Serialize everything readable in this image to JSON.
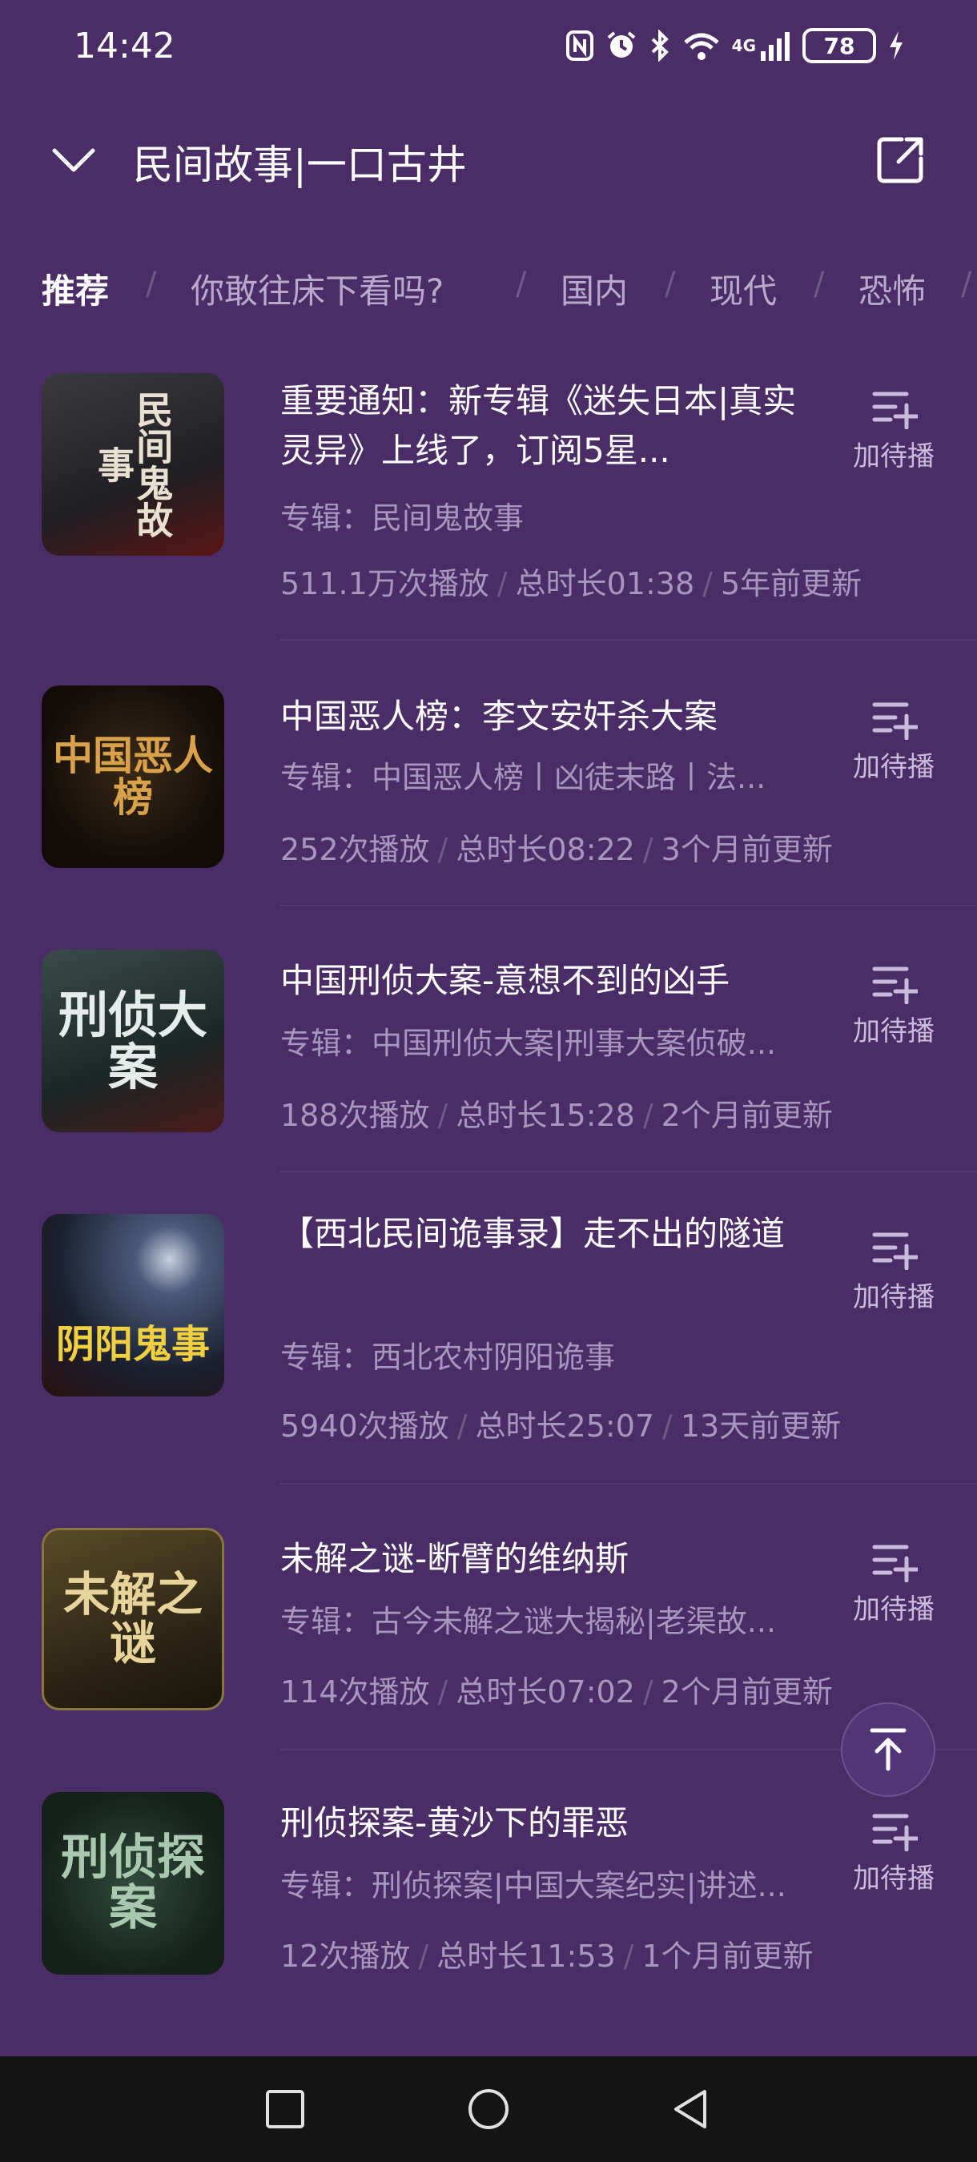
{
  "status_bar": {
    "time": "14:42",
    "icons": [
      "nfc-icon",
      "alarm-icon",
      "bluetooth-icon",
      "wifi-icon",
      "signal-icon",
      "charging-icon"
    ],
    "network_label": "4G",
    "battery_level": "78"
  },
  "header": {
    "title": "民间故事|一口古井",
    "back_icon": "chevron-down-icon",
    "share_icon": "share-icon"
  },
  "tabs": [
    {
      "label": "推荐",
      "active": true
    },
    {
      "label": "你敢往床下看吗?",
      "active": false
    },
    {
      "label": "国内",
      "active": false
    },
    {
      "label": "现代",
      "active": false
    },
    {
      "label": "恐怖",
      "active": false
    }
  ],
  "queue_label": "加待播",
  "items": [
    {
      "title": "重要通知：新专辑《迷失日本|真实灵异》上线了，订阅5星...",
      "album": "专辑：民间鬼故事",
      "plays": "511.1万次播放",
      "duration": "总时长01:38",
      "updated": "5年前更新",
      "cover_text": "民间鬼故事"
    },
    {
      "title": "中国恶人榜：李文安奸杀大案",
      "album": "专辑：中国恶人榜丨凶徒末路丨法...",
      "plays": "252次播放",
      "duration": "总时长08:22",
      "updated": "3个月前更新",
      "cover_text": "中国恶人榜"
    },
    {
      "title": "中国刑侦大案-意想不到的凶手",
      "album": "专辑：中国刑侦大案|刑事大案侦破...",
      "plays": "188次播放",
      "duration": "总时长15:28",
      "updated": "2个月前更新",
      "cover_text": "刑侦大案"
    },
    {
      "title": "【西北民间诡事录】走不出的隧道",
      "album": "专辑：西北农村阴阳诡事",
      "plays": "5940次播放",
      "duration": "总时长25:07",
      "updated": "13天前更新",
      "cover_text": "阴阳鬼事"
    },
    {
      "title": "未解之谜-断臂的维纳斯",
      "album": "专辑：古今未解之谜大揭秘|老渠故...",
      "plays": "114次播放",
      "duration": "总时长07:02",
      "updated": "2个月前更新",
      "cover_text": "未解之谜"
    },
    {
      "title": "刑侦探案-黄沙下的罪恶",
      "album": "专辑：刑侦探案|中国大案纪实|讲述...",
      "plays": "12次播放",
      "duration": "总时长11:53",
      "updated": "1个月前更新",
      "cover_text": "刑侦探案"
    }
  ],
  "scroll_top_icon": "arrow-up-icon",
  "nav_bar": {
    "icons": [
      "recent-apps-icon",
      "home-icon",
      "back-icon"
    ]
  }
}
